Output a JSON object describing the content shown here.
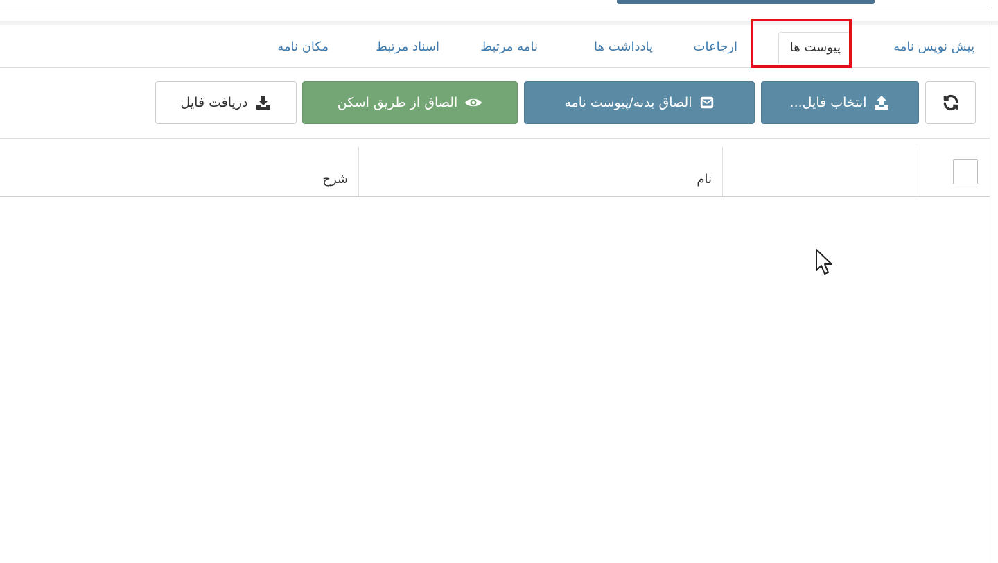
{
  "tabs": [
    {
      "label": "پیش نویس نامه",
      "active": false
    },
    {
      "label": "پیوست ها",
      "active": true
    },
    {
      "label": "ارجاعات",
      "active": false
    },
    {
      "label": "یادداشت ها",
      "active": false
    },
    {
      "label": "نامه مرتبط",
      "active": false
    },
    {
      "label": "اسناد مرتبط",
      "active": false
    },
    {
      "label": "مکان نامه",
      "active": false
    }
  ],
  "toolbar": {
    "refresh_icon": "refresh-icon",
    "select_file_label": "انتخاب فایل...",
    "select_file_icon": "upload-icon",
    "attach_body_label": "الصاق بدنه/پیوست نامه",
    "attach_body_icon": "envelope-icon",
    "attach_scan_label": "الصاق از طریق اسکن",
    "attach_scan_icon": "eye-icon",
    "download_label": "دریافت فایل",
    "download_icon": "download-icon"
  },
  "table": {
    "columns": [
      "نام",
      "شرح"
    ],
    "rows": []
  },
  "colors": {
    "tab_link": "#3e7cb0",
    "btn_blue": "#5a8aa4",
    "btn_green": "#74a574",
    "highlight": "#e41019"
  }
}
